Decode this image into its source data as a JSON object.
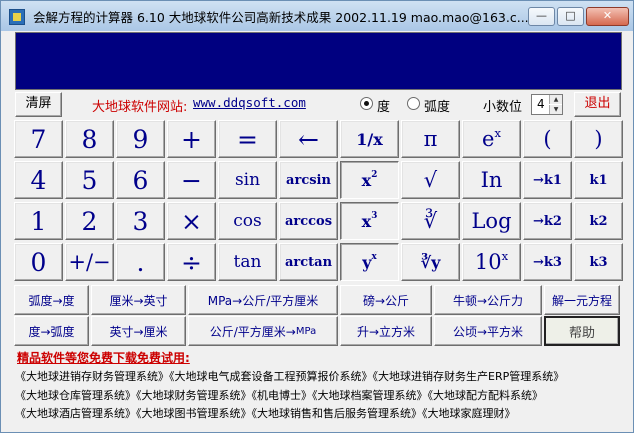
{
  "window": {
    "title": "会解方程的计算器 6.10    大地球软件公司高新技术成果   2002.11.19    mao.mao@163.c...",
    "min_glyph": "—",
    "max_glyph": "□",
    "close_glyph": "✕"
  },
  "display": {
    "value": "",
    "background": "#000080"
  },
  "toolbar": {
    "clear_label": "清屏",
    "site_label": "大地球软件网站:",
    "site_url": "www.ddqsoft.com",
    "degree_label": "度",
    "radian_label": "弧度",
    "angle_mode": "degree",
    "decimal_label": "小数位",
    "decimal_value": "4",
    "exit_label": "退出"
  },
  "keys": {
    "r1": [
      "7",
      "8",
      "9",
      "+",
      "=",
      "←",
      "1/x",
      "π",
      "e",
      "x",
      "(",
      ")"
    ],
    "r2": [
      "4",
      "5",
      "6",
      "−",
      "sin",
      "arcsin",
      "x",
      "2",
      "√",
      "In",
      "→k1",
      "k1"
    ],
    "r3": [
      "1",
      "2",
      "3",
      "×",
      "cos",
      "arccos",
      "x",
      "3",
      "∛",
      "Log",
      "→k2",
      "k2"
    ],
    "r4": [
      "0",
      "+/−",
      ".",
      "÷",
      "tan",
      "arctan",
      "y",
      "x",
      "∛y",
      "10",
      "x",
      "→k3",
      "k3"
    ]
  },
  "conversions": {
    "row1": [
      "弧度→度",
      "厘米→英寸",
      "MPa→公斤/平方厘米",
      "磅→公斤",
      "牛顿→公斤力",
      "解一元方程"
    ],
    "row2": [
      "度→弧度",
      "英寸→厘米",
      "公斤/平方厘米→",
      "MPa",
      "升→立方米",
      "公顷→平方米",
      "帮助"
    ]
  },
  "recommend": {
    "title": "精品软件等您免费下载免费试用:",
    "line1": "《大地球进销存财务管理系统》《大地球电气成套设备工程预算报价系统》《大地球进销存财务生产ERP管理系统》",
    "line2": "《大地球仓库管理系统》《大地球财务管理系统》《机电博士》《大地球档案管理系统》《大地球配方配料系统》",
    "line3": "《大地球酒店管理系统》《大地球图书管理系统》《大地球销售和售后服务管理系统》《大地球家庭理财》"
  },
  "colors": {
    "key_text": "#00008b",
    "accent_red": "#cc0000",
    "display": "#000080"
  }
}
